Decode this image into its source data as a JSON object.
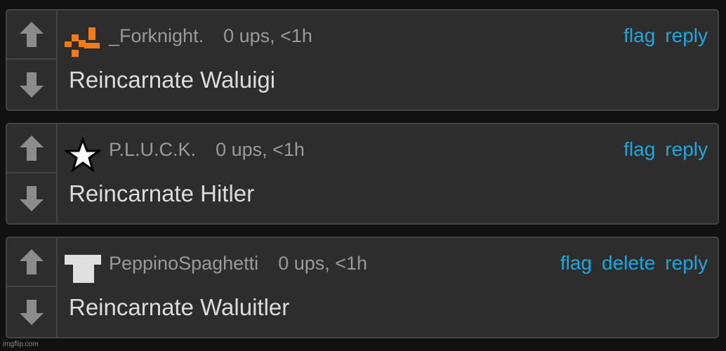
{
  "colors": {
    "background": "#111111",
    "card": "#2d2d2d",
    "border": "#444444",
    "link": "#1ba9dd",
    "meta_text": "#9a9a9a",
    "body_text": "#dcdcdc",
    "vote_arrow": "#8c8c8c",
    "forknight_avatar": "#f47a14"
  },
  "comments": [
    {
      "username": "_Forknight.",
      "stats": "0 ups, <1h",
      "avatar_icon": "orange-pixel-avatar-icon",
      "text": "Reincarnate Waluigi",
      "actions": [
        "flag",
        "reply"
      ]
    },
    {
      "username": "P.L.U.C.K.",
      "stats": "0 ups, <1h",
      "avatar_icon": "star-avatar-icon",
      "text": "Reincarnate Hitler",
      "actions": [
        "flag",
        "reply"
      ]
    },
    {
      "username": "PeppinoSpaghetti",
      "stats": "0 ups, <1h",
      "avatar_icon": "shirt-avatar-icon",
      "text": "Reincarnate Waluitler",
      "actions": [
        "flag",
        "delete",
        "reply"
      ]
    }
  ],
  "watermark": "imgflip.com"
}
